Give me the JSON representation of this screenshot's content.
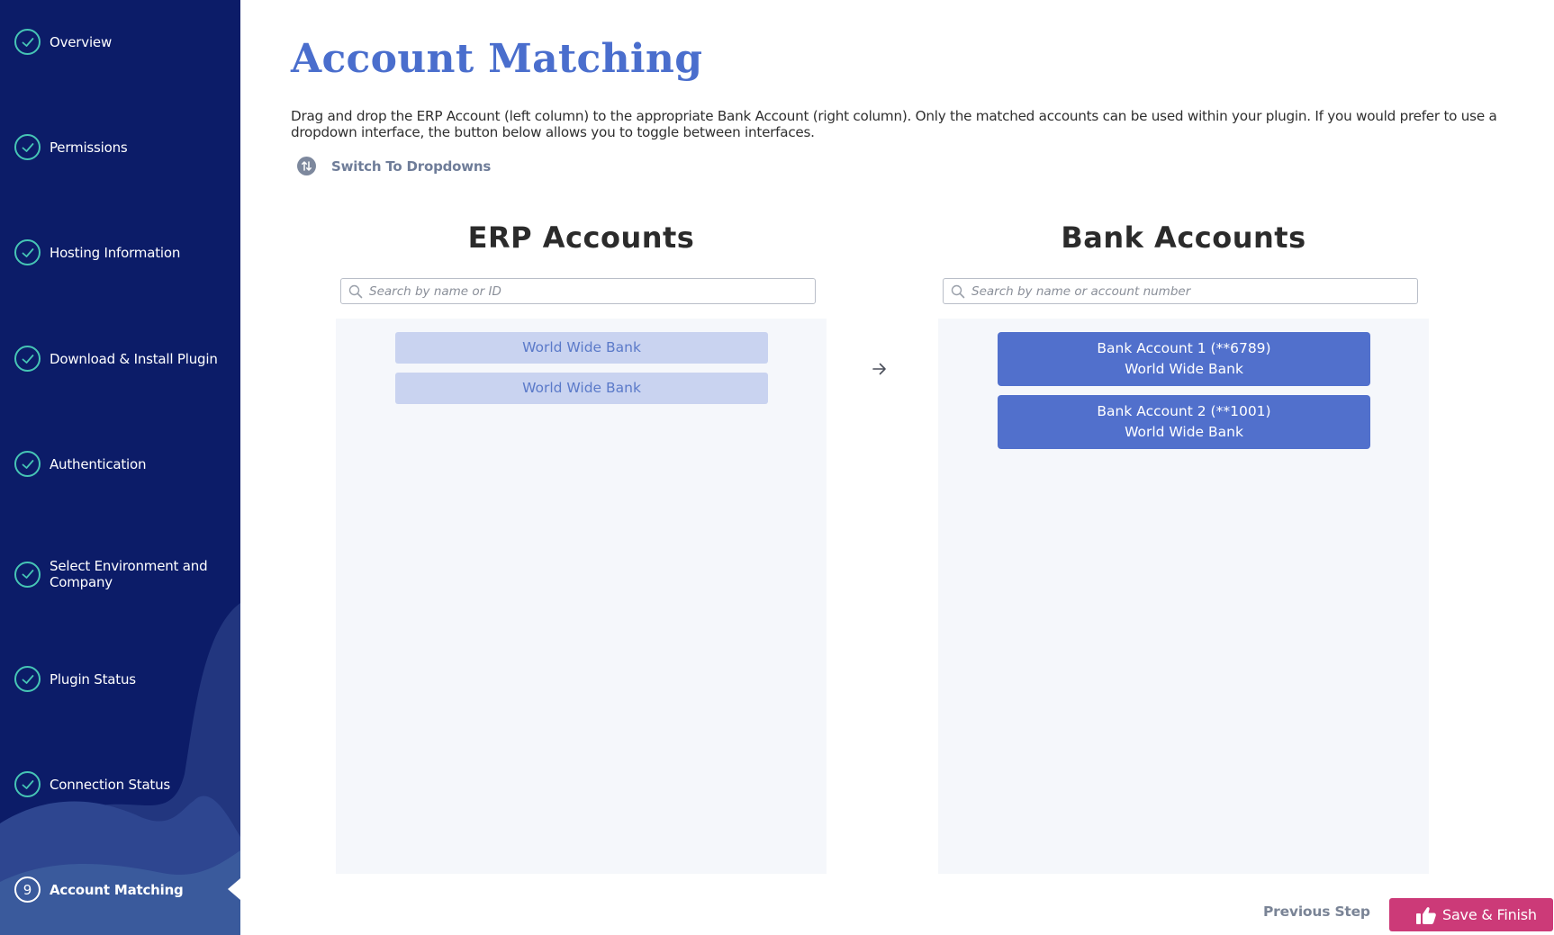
{
  "colors": {
    "sidebar_bg": "#0c1c68",
    "check_accent": "#46c5b5",
    "title_blue": "#4a6ecd",
    "bank_item_bg": "#5170cc",
    "erp_item_bg": "#c9d3f0",
    "save_button_bg": "#cc3a78"
  },
  "sidebar": {
    "steps": [
      {
        "label": "Overview",
        "status": "complete",
        "icon": "check-icon"
      },
      {
        "label": "Permissions",
        "status": "complete",
        "icon": "check-icon"
      },
      {
        "label": "Hosting Information",
        "status": "complete",
        "icon": "check-icon"
      },
      {
        "label": "Download & Install Plugin",
        "status": "complete",
        "icon": "check-icon"
      },
      {
        "label": "Authentication",
        "status": "complete",
        "icon": "check-icon"
      },
      {
        "label": "Select Environment and Company",
        "status": "complete",
        "icon": "check-icon"
      },
      {
        "label": "Plugin Status",
        "status": "complete",
        "icon": "check-icon"
      },
      {
        "label": "Connection Status",
        "status": "complete",
        "icon": "check-icon"
      },
      {
        "label": "Account Matching",
        "status": "active",
        "number": "9"
      }
    ]
  },
  "main": {
    "title": "Account Matching",
    "description": "Drag and drop the ERP Account (left column) to the appropriate Bank Account (right column). Only the matched accounts can be used within your plugin. If you would prefer to use a dropdown interface, the button below allows you to toggle between interfaces.",
    "switch_label": "Switch To Dropdowns",
    "erp": {
      "heading": "ERP Accounts",
      "search_placeholder": "Search by name or ID",
      "items": [
        "World Wide Bank",
        "World Wide Bank"
      ]
    },
    "bank": {
      "heading": "Bank Accounts",
      "search_placeholder": "Search by name or account number",
      "items": [
        {
          "line1": "Bank Account 1 (**6789)",
          "line2": "World Wide Bank"
        },
        {
          "line1": "Bank Account 2 (**1001)",
          "line2": "World Wide Bank"
        }
      ]
    },
    "footer": {
      "previous_label": "Previous Step",
      "save_label": "Save & Finish"
    }
  }
}
